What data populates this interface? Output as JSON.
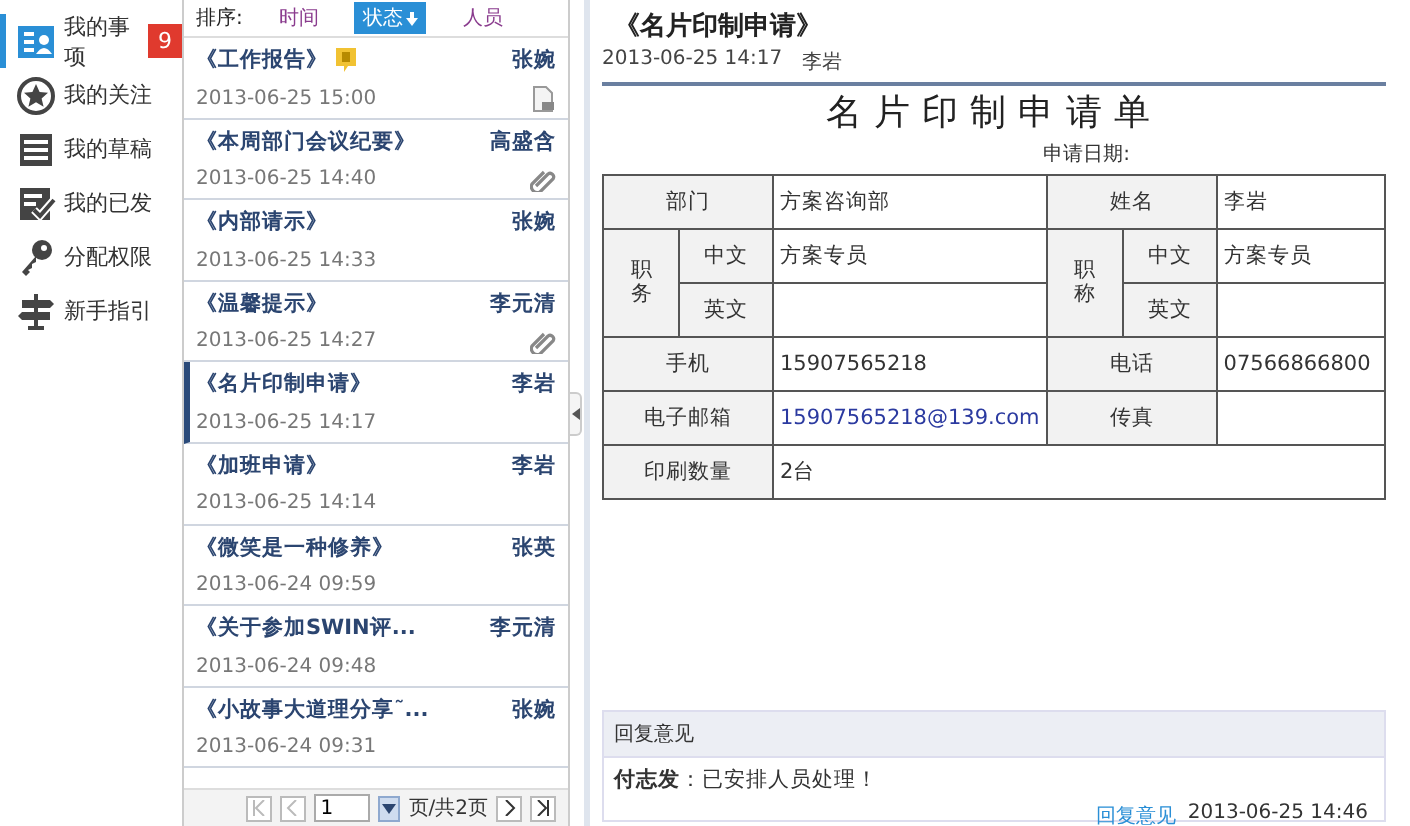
{
  "sidebar": {
    "items": [
      {
        "label": "我的事项",
        "badge": "9",
        "selected": true
      },
      {
        "label": "我的关注",
        "selected": false
      },
      {
        "label": "我的草稿",
        "selected": false
      },
      {
        "label": "我的已发",
        "selected": false
      },
      {
        "label": "分配权限",
        "selected": false
      },
      {
        "label": "新手指引",
        "selected": false
      }
    ]
  },
  "list": {
    "sort": {
      "label": "排序:",
      "options": [
        {
          "label": "时间",
          "selected": false
        },
        {
          "label": "状态",
          "selected": true
        },
        {
          "label": "人员",
          "selected": false
        }
      ]
    },
    "items": [
      {
        "title": "《工作报告》",
        "author": "张婉",
        "date": "2013-06-25 15:00",
        "flagged": true,
        "kind": "document",
        "selected": false
      },
      {
        "title": "《本周部门会议纪要》",
        "author": "高盛含",
        "date": "2013-06-25 14:40",
        "flagged": false,
        "kind": "attachment",
        "selected": false
      },
      {
        "title": "《内部请示》",
        "author": "张婉",
        "date": "2013-06-25 14:33",
        "flagged": false,
        "kind": "plain",
        "selected": false
      },
      {
        "title": "《温馨提示》",
        "author": "李元清",
        "date": "2013-06-25 14:27",
        "flagged": false,
        "kind": "attachment",
        "selected": false
      },
      {
        "title": "《名片印制申请》",
        "author": "李岩",
        "date": "2013-06-25 14:17",
        "flagged": false,
        "kind": "plain",
        "selected": true
      },
      {
        "title": "《加班申请》",
        "author": "李岩",
        "date": "2013-06-25 14:14",
        "flagged": false,
        "kind": "plain",
        "selected": false
      },
      {
        "title": "《微笑是一种修养》",
        "author": "张英",
        "date": "2013-06-24 09:59",
        "flagged": false,
        "kind": "plain",
        "selected": false
      },
      {
        "title": "《关于参加SWIN评...",
        "author": "李元清",
        "date": "2013-06-24 09:48",
        "flagged": false,
        "kind": "plain",
        "selected": false
      },
      {
        "title": "《小故事大道理分享˜...",
        "author": "张婉",
        "date": "2013-06-24 09:31",
        "flagged": false,
        "kind": "plain",
        "selected": false
      }
    ],
    "pager": {
      "page": "1",
      "total": "页/共2页"
    }
  },
  "document": {
    "title": "《名片印制申请》",
    "date": "2013-06-25 14:17",
    "author": "李岩",
    "form": {
      "title": "名片印制申请单",
      "date_label": "申请日期:",
      "rows": [
        [
          {
            "kind": "label",
            "text": "部门",
            "colspan": 2
          },
          {
            "kind": "value",
            "text": "方案咨询部"
          },
          {
            "kind": "label",
            "text": "姓名",
            "colspan": 2
          },
          {
            "kind": "value",
            "text": "李岩"
          }
        ],
        [
          {
            "kind": "vlabel",
            "text": "职务",
            "rowspan": 2
          },
          {
            "kind": "label",
            "text": "中文"
          },
          {
            "kind": "value",
            "text": "方案专员"
          },
          {
            "kind": "vlabel",
            "text": "职称",
            "rowspan": 2
          },
          {
            "kind": "label",
            "text": "中文"
          },
          {
            "kind": "value",
            "text": "方案专员"
          }
        ],
        [
          {
            "kind": "label",
            "text": "英文"
          },
          {
            "kind": "empty"
          },
          {
            "kind": "label",
            "text": "英文"
          },
          {
            "kind": "empty"
          }
        ],
        [
          {
            "kind": "label",
            "text": "手机",
            "colspan": 2
          },
          {
            "kind": "value",
            "text": "15907565218"
          },
          {
            "kind": "label",
            "text": "电话",
            "colspan": 2
          },
          {
            "kind": "value",
            "text": "07566866800"
          }
        ],
        [
          {
            "kind": "label",
            "text": "电子邮箱",
            "colspan": 2
          },
          {
            "kind": "link",
            "text": "15907565218@139.com"
          },
          {
            "kind": "label",
            "text": "传真",
            "colspan": 2
          },
          {
            "kind": "empty"
          }
        ],
        [
          {
            "kind": "label",
            "text": "印刷数量",
            "colspan": 2
          },
          {
            "kind": "value",
            "text": "2台",
            "colspan": 4
          }
        ]
      ]
    },
    "reply": {
      "title": "回复意见",
      "author": "付志发",
      "text": "：已安排人员处理！",
      "link": "回复意见",
      "date": "2013-06-25 14:46"
    }
  }
}
